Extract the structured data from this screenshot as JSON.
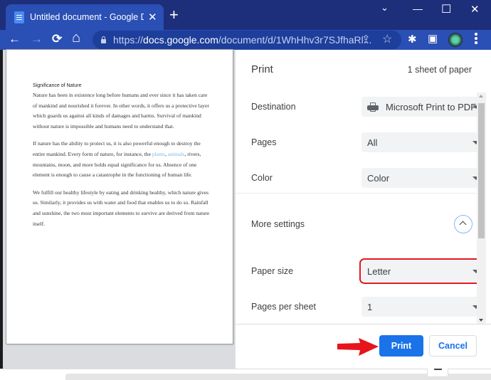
{
  "browser": {
    "tab": {
      "title": "Untitled document - Google Doc",
      "icon": "google-docs-icon",
      "close_glyph": "✕"
    },
    "new_tab_glyph": "+",
    "window_controls": {
      "tab_search": "⌄",
      "minimize": "—",
      "maximize": "☐",
      "close": "✕"
    },
    "nav": {
      "back": "←",
      "forward": "→",
      "reload": "⟳",
      "home": "⌂"
    },
    "url_prefix": "https://",
    "url_host": "docs.google.com",
    "url_path": "/document/d/1WhHhv3r7SJfhaRl...",
    "omnibox_icons": {
      "share": "⇪",
      "bookmark": "☆"
    },
    "toolbar_icons": {
      "extensions": "✱",
      "side_panel": "▣"
    }
  },
  "document": {
    "title": "Significance of Nature",
    "paragraphs": [
      {
        "segments": [
          {
            "text": "Nature has been in existence long before humans and ever since it has taken care of mankind and nourished it forever. In other words, it offers us a protective layer which guards us against all kinds of damages and harms. Survival of mankind without nature is impossible and humans need to understand that."
          }
        ]
      },
      {
        "pre": "If nature has the ability to protect us, it is also powerful enough to destroy the entire mankind. Every form of nature, for instance, the ",
        "link1": "plants",
        "sep": ", ",
        "link2": "animals",
        "post": ", rivers, mountains, moon, and more holds equal significance for us. Absence of one element is enough to cause a catastrophe in the functioning of human life."
      },
      {
        "text": "We fulfill our healthy lifestyle by eating and drinking healthy, which nature gives us. Similarly, it provides us with water and food that enables us to do so. Rainfall and sunshine, the two most important elements to survive are derived from nature itself."
      }
    ]
  },
  "print_panel": {
    "title": "Print",
    "sheet_count": "1 sheet of paper",
    "settings": [
      {
        "label": "Destination",
        "value": "Microsoft Print to PDF"
      },
      {
        "label": "Pages",
        "value": "All"
      },
      {
        "label": "Color",
        "value": "Color"
      }
    ],
    "more_settings_label": "More settings",
    "more_settings": [
      {
        "label": "Paper size",
        "value": "Letter",
        "highlighted": true
      },
      {
        "label": "Pages per sheet",
        "value": "1"
      }
    ],
    "buttons": {
      "print": "Print",
      "cancel": "Cancel"
    },
    "annotation": {
      "highlight_color": "#e0161e",
      "arrow_color": "#e8141b"
    },
    "accent_color": "#1a73e8"
  }
}
